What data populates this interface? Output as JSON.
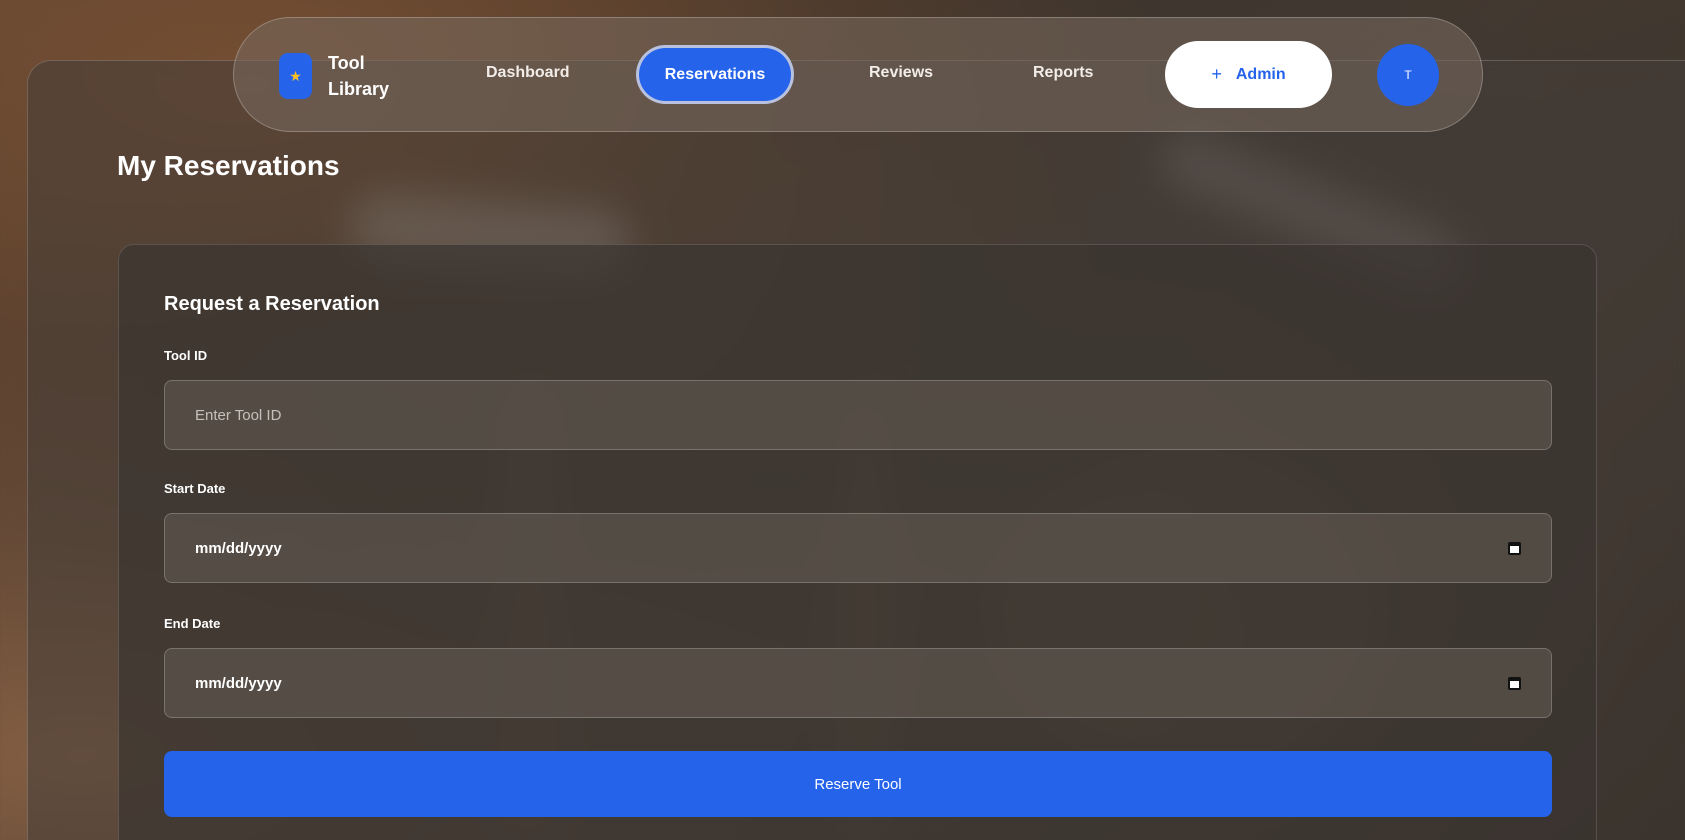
{
  "nav": {
    "brand_name": "Tool Library",
    "brand_icon": "star-icon",
    "links": {
      "dashboard": "Dashboard",
      "reservations": "Reservations",
      "reviews": "Reviews",
      "reports": "Reports"
    },
    "active": "Reservations",
    "admin_button": "Admin",
    "admin_icon": "plus-icon",
    "avatar_initial": "T"
  },
  "page": {
    "title": "My Reservations"
  },
  "form": {
    "title": "Request a Reservation",
    "tool_id": {
      "label": "Tool ID",
      "placeholder": "Enter Tool ID",
      "value": ""
    },
    "start_date": {
      "label": "Start Date",
      "value": "mm/dd/yyyy"
    },
    "end_date": {
      "label": "End Date",
      "value": "mm/dd/yyyy"
    },
    "submit": "Reserve Tool"
  },
  "colors": {
    "accent": "#2563eb",
    "star": "#fbbf24"
  }
}
